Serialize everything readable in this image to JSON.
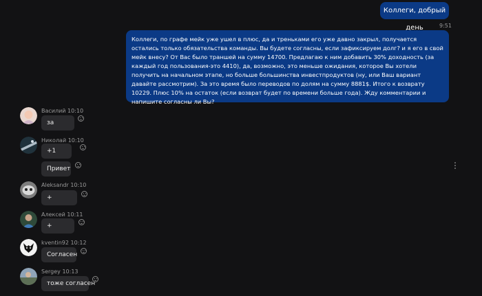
{
  "outgoing": [
    {
      "text": "Коллеги, добрый день",
      "time": "9:51"
    },
    {
      "text": "Коллеги, по графе мейк уже ушел в плюс, да и треньками его уже давно закрыл, получается остались только обязательства команды. Вы будете согласны, если зафиксируем долг? и я его в свой мейк внесу? От Вас было траншей на сумму 14700. Предлагаю к ним добавить 30% доходность (за каждый год пользования-это 4410), да, возможно, это меньше ожидания, которое Вы хотели получить на начальном этапе, но больше большинства инвестпродуктов (ну, или Ваш вариант давайте рассмотрим). За это время было переводов по долям на сумму 8881$. Итого к возврату 10229. Плюс 10% на остаток (если возврат будет по времени больше года). Жду комментарии и напишите согласны ли Вы?"
    }
  ],
  "incoming": [
    {
      "author": "Василий",
      "time": "10:10",
      "messages": [
        "за"
      ]
    },
    {
      "author": "Николай",
      "time": "10:10",
      "messages": [
        "+1",
        "Привет"
      ]
    },
    {
      "author": "Aleksandr",
      "time": "10:10",
      "messages": [
        "+"
      ]
    },
    {
      "author": "Алексей",
      "time": "10:11",
      "messages": [
        "+"
      ]
    },
    {
      "author": "kventin92",
      "time": "10:12",
      "messages": [
        "Согласен"
      ]
    },
    {
      "author": "Sergey",
      "time": "10:13",
      "messages": [
        "тоже согласен"
      ]
    }
  ],
  "icons": {
    "reaction": "smiley-icon",
    "menu": "kebab-menu-icon"
  },
  "colors": {
    "background": "#121214",
    "outgoing_bubble": "#0b3a86",
    "incoming_bubble": "#2b2b2e"
  }
}
